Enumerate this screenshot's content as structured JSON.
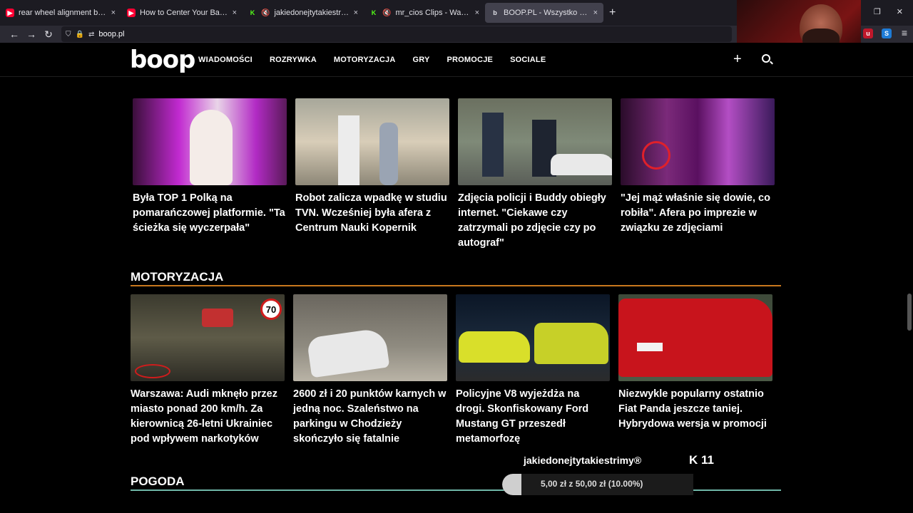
{
  "browser": {
    "tabs": [
      {
        "title": "rear wheel alignment bike - You",
        "icon": "youtube-icon",
        "muted": false,
        "active": false
      },
      {
        "title": "How to Center Your Back Whee",
        "icon": "youtube-icon",
        "muted": false,
        "active": false
      },
      {
        "title": "jakiedonejtytakiestrimyxD S",
        "icon": "kick-icon",
        "muted": true,
        "active": false
      },
      {
        "title": "mr_cios Clips - Watch Live",
        "icon": "kick-icon",
        "muted": true,
        "active": false
      },
      {
        "title": "BOOP.PL - Wszystko co chcesz",
        "icon": "boop-icon",
        "muted": false,
        "active": true
      }
    ],
    "url": "boop.pl",
    "new_tab": "+",
    "close": "×"
  },
  "site": {
    "logo": "boop",
    "nav": [
      "WIADOMOŚCI",
      "ROZRYWKA",
      "MOTORYZACJA",
      "GRY",
      "PROMOCJE",
      "SOCIALE"
    ],
    "top_articles": [
      {
        "title": "Była TOP 1 Polką na pomarańczowej platformie. \"Ta ścieżka się wyczerpała\""
      },
      {
        "title": "Robot zalicza wpadkę w studiu TVN. Wcześniej była afera z Centrum Nauki Kopernik"
      },
      {
        "title": "Zdjęcia policji i Buddy obiegły internet. \"Ciekawe czy zatrzymali po zdjęcie czy po autograf\""
      },
      {
        "title": "\"Jej mąż właśnie się dowie, co robiła\". Afera po imprezie w związku ze zdjęciami"
      }
    ],
    "moto_section": {
      "title": "MOTORYZACJA",
      "accent": "#c9781e",
      "speed_sign": "70",
      "articles": [
        {
          "title": "Warszawa: Audi mknęło przez miasto ponad 200 km/h. Za kierownicą 26-letni Ukrainiec pod wpływem narkotyków"
        },
        {
          "title": "2600 zł i 20 punktów karnych w jedną noc. Szaleństwo na parkingu w Chodzieży skończyło się fatalnie"
        },
        {
          "title": "Policyjne V8 wyjeżdża na drogi. Skonfiskowany Ford Mustang GT przeszedł metamorfozę"
        },
        {
          "title": "Niezwykle popularny ostatnio Fiat Panda jeszcze taniej. Hybrydowa wersja w promocji"
        }
      ]
    },
    "weather_section": {
      "title": "POGODA",
      "accent": "#6fb8a8"
    }
  },
  "overlay": {
    "channel": "jakiedonejtytakiestrimy®",
    "k_count": "11",
    "progress_text": "5,00 zł z 50,00 zł (10.00%)",
    "progress_fraction": 0.1
  }
}
